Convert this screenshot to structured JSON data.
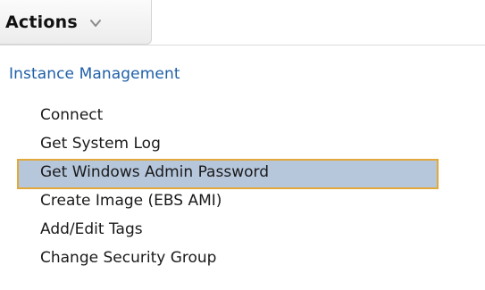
{
  "actions_tab": {
    "label": "Actions",
    "chevron_icon": "chevron-down-icon"
  },
  "menu": {
    "group_header": "Instance Management",
    "items": [
      {
        "label": "Connect",
        "selected": false
      },
      {
        "label": "Get System Log",
        "selected": false
      },
      {
        "label": "Get Windows Admin Password",
        "selected": true
      },
      {
        "label": "Create Image (EBS AMI)",
        "selected": false
      },
      {
        "label": "Add/Edit Tags",
        "selected": false
      },
      {
        "label": "Change Security Group",
        "selected": false
      }
    ]
  },
  "colors": {
    "group_header": "#1f5fa8",
    "selected_background": "#b6c7dc",
    "selected_border": "#e2a93a"
  }
}
